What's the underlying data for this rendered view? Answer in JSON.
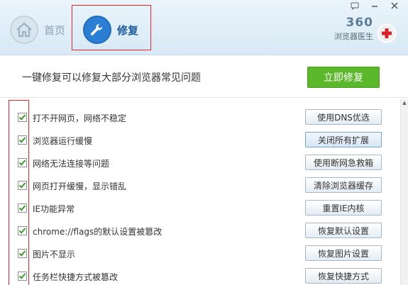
{
  "header": {
    "tabs": [
      {
        "label": "首页",
        "icon": "home-icon"
      },
      {
        "label": "修复",
        "icon": "wrench-icon",
        "selected": true
      }
    ],
    "brand": {
      "number": "360",
      "name": "浏览器医生"
    }
  },
  "banner": {
    "text": "一键修复可以修复大部分浏览器常见问题",
    "button": "立即修复"
  },
  "items": [
    {
      "label": "打不开网页，网络不稳定",
      "button": "使用DNS优选",
      "checked": true
    },
    {
      "label": "浏览器运行缓慢",
      "button": "关闭所有扩展",
      "checked": true
    },
    {
      "label": "网络无法连接等问题",
      "button": "使用断网急救箱",
      "checked": true
    },
    {
      "label": "网页打开缓慢，显示错乱",
      "button": "清除浏览器缓存",
      "checked": true
    },
    {
      "label": "IE功能异常",
      "button": "重置IE内核",
      "checked": true
    },
    {
      "label": "chrome://flags的默认设置被篡改",
      "button": "恢复默认设置",
      "checked": true
    },
    {
      "label": "图片不显示",
      "button": "恢复图片设置",
      "checked": true
    },
    {
      "label": "任务栏快捷方式被篡改",
      "button": "恢复快捷方式",
      "checked": true
    }
  ],
  "colors": {
    "accent": "#2a7ed3",
    "green": "#5cb82b",
    "highlight": "#ee2222"
  }
}
